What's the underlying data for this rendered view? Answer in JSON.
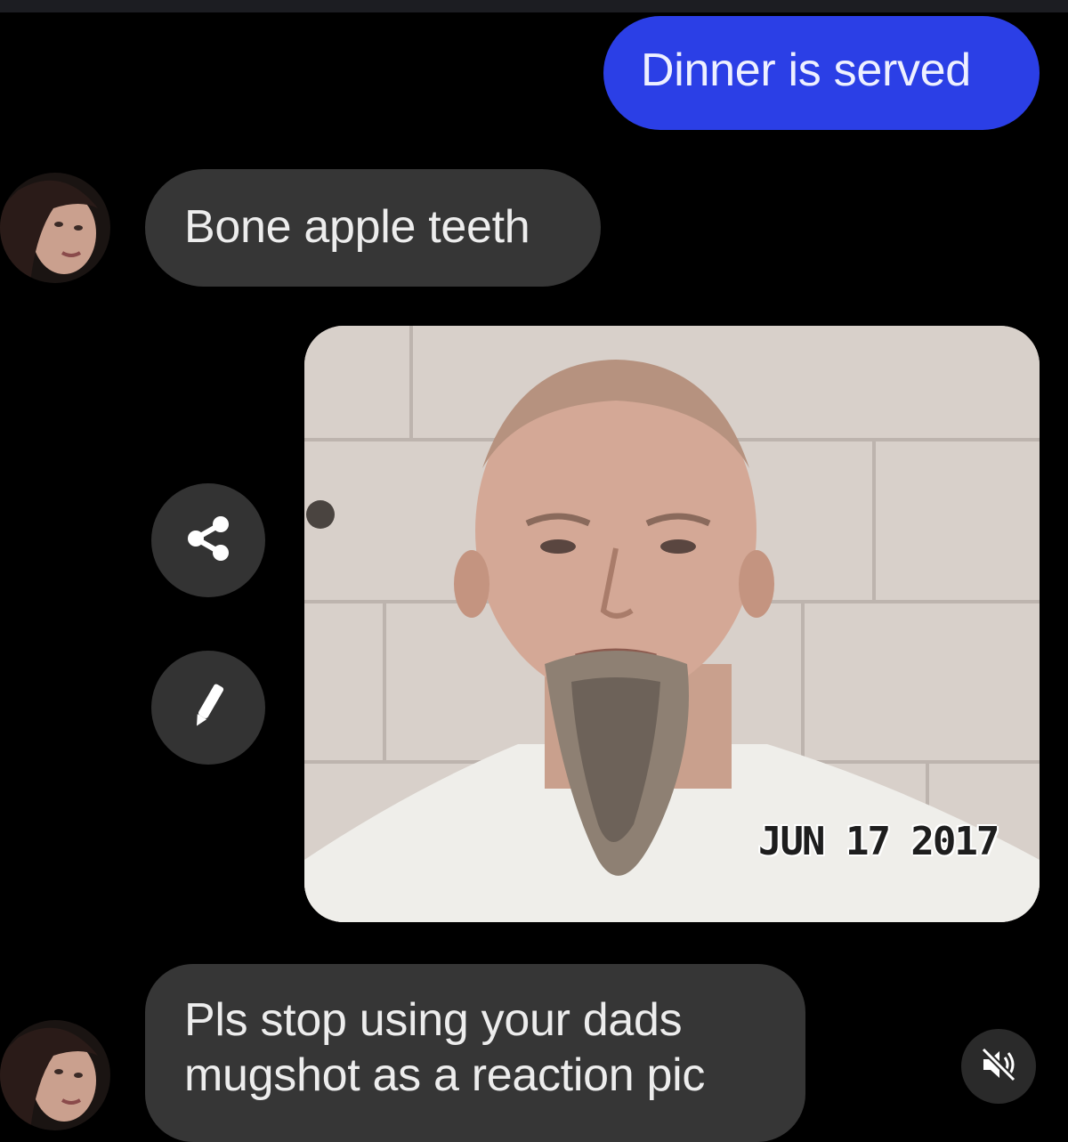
{
  "conversation": {
    "messages": [
      {
        "sender": "me",
        "type": "text",
        "text": "Dinner is served"
      },
      {
        "sender": "contact",
        "type": "text",
        "text": "Bone apple teeth"
      },
      {
        "sender": "me",
        "type": "image",
        "stamp": "JUN 17 2017"
      },
      {
        "sender": "contact",
        "type": "text",
        "lines": [
          "Pls stop using your dads",
          "mugshot as a reaction pic"
        ]
      }
    ]
  },
  "actions": {
    "share_icon": "share-icon",
    "edit_icon": "pencil-icon",
    "mute_icon": "speaker-muted-icon"
  },
  "colors": {
    "background": "#000000",
    "outgoing_bubble": "#2b3fe6",
    "incoming_bubble": "#363636"
  }
}
